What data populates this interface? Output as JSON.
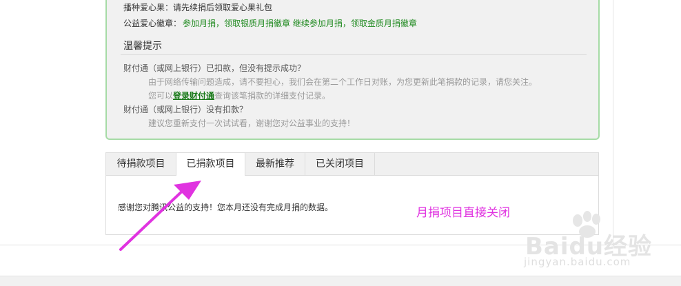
{
  "notice": {
    "rows": [
      {
        "label": "播种爱心果：",
        "value": "请先续捐后领取爱心果礼包"
      },
      {
        "label": "公益爱心徽章：",
        "value": "参加月捐，领取银质月捐徽章 继续参加月捐，领取金质月捐徽章"
      }
    ],
    "tips_title": "温馨提示",
    "q1": "财付通（或网上银行）已扣款，但没有提示成功？",
    "a1": "由于网络传输问题造成，请不要担心，我们会在第二个工作日对账，为您更新此笔捐款的记录，请您关注。",
    "a2_prefix": "您可以",
    "a2_link": "登录财付通",
    "a2_suffix": "查询该笔捐款的详细支付记录。",
    "q2": "财付通（或网上银行）没有扣款？",
    "a3": "建议您重新支付一次试试看，谢谢您对公益事业的支持！"
  },
  "tabs": [
    {
      "label": "待捐款项目",
      "active": false
    },
    {
      "label": "已捐款项目",
      "active": true
    },
    {
      "label": "最新推荐",
      "active": false
    },
    {
      "label": "已关闭项目",
      "active": false
    }
  ],
  "tab_content": "感谢您对腾讯公益的支持！您本月还没有完成月捐的数据。",
  "annotation": "月捐项目直接关闭",
  "watermark": {
    "brand": "Baidu经验",
    "url": "jingyan.baidu.com"
  },
  "colors": {
    "accent_green": "#208a20",
    "annotation_magenta": "#e033e0",
    "border_green": "#a6dba6"
  }
}
